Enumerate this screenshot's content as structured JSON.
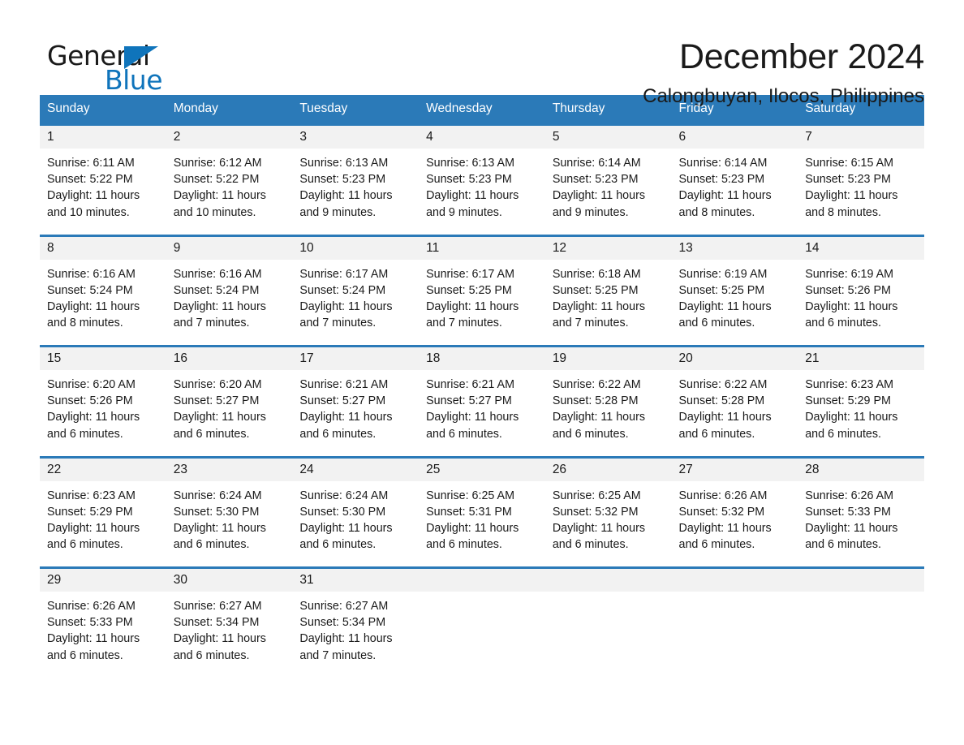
{
  "brand": {
    "name_part1": "General",
    "name_part2": "Blue",
    "triangle_color": "#0f74bb",
    "blue_color": "#0f74bb"
  },
  "header": {
    "month_title": "December 2024",
    "location": "Calongbuyan, Ilocos, Philippines"
  },
  "theme": {
    "header_bg": "#2b7ab8",
    "header_text": "#ffffff",
    "daynum_bg": "#f2f2f2",
    "row_border": "#2b7ab8",
    "page_bg": "#ffffff"
  },
  "weekdays": [
    "Sunday",
    "Monday",
    "Tuesday",
    "Wednesday",
    "Thursday",
    "Friday",
    "Saturday"
  ],
  "labels": {
    "sunrise_prefix": "Sunrise:",
    "sunset_prefix": "Sunset:",
    "daylight_prefix": "Daylight:"
  },
  "weeks": [
    [
      {
        "day": "1",
        "sunrise": "Sunrise: 6:11 AM",
        "sunset": "Sunset: 5:22 PM",
        "daylight_line1": "Daylight: 11 hours",
        "daylight_line2": "and 10 minutes."
      },
      {
        "day": "2",
        "sunrise": "Sunrise: 6:12 AM",
        "sunset": "Sunset: 5:22 PM",
        "daylight_line1": "Daylight: 11 hours",
        "daylight_line2": "and 10 minutes."
      },
      {
        "day": "3",
        "sunrise": "Sunrise: 6:13 AM",
        "sunset": "Sunset: 5:23 PM",
        "daylight_line1": "Daylight: 11 hours",
        "daylight_line2": "and 9 minutes."
      },
      {
        "day": "4",
        "sunrise": "Sunrise: 6:13 AM",
        "sunset": "Sunset: 5:23 PM",
        "daylight_line1": "Daylight: 11 hours",
        "daylight_line2": "and 9 minutes."
      },
      {
        "day": "5",
        "sunrise": "Sunrise: 6:14 AM",
        "sunset": "Sunset: 5:23 PM",
        "daylight_line1": "Daylight: 11 hours",
        "daylight_line2": "and 9 minutes."
      },
      {
        "day": "6",
        "sunrise": "Sunrise: 6:14 AM",
        "sunset": "Sunset: 5:23 PM",
        "daylight_line1": "Daylight: 11 hours",
        "daylight_line2": "and 8 minutes."
      },
      {
        "day": "7",
        "sunrise": "Sunrise: 6:15 AM",
        "sunset": "Sunset: 5:23 PM",
        "daylight_line1": "Daylight: 11 hours",
        "daylight_line2": "and 8 minutes."
      }
    ],
    [
      {
        "day": "8",
        "sunrise": "Sunrise: 6:16 AM",
        "sunset": "Sunset: 5:24 PM",
        "daylight_line1": "Daylight: 11 hours",
        "daylight_line2": "and 8 minutes."
      },
      {
        "day": "9",
        "sunrise": "Sunrise: 6:16 AM",
        "sunset": "Sunset: 5:24 PM",
        "daylight_line1": "Daylight: 11 hours",
        "daylight_line2": "and 7 minutes."
      },
      {
        "day": "10",
        "sunrise": "Sunrise: 6:17 AM",
        "sunset": "Sunset: 5:24 PM",
        "daylight_line1": "Daylight: 11 hours",
        "daylight_line2": "and 7 minutes."
      },
      {
        "day": "11",
        "sunrise": "Sunrise: 6:17 AM",
        "sunset": "Sunset: 5:25 PM",
        "daylight_line1": "Daylight: 11 hours",
        "daylight_line2": "and 7 minutes."
      },
      {
        "day": "12",
        "sunrise": "Sunrise: 6:18 AM",
        "sunset": "Sunset: 5:25 PM",
        "daylight_line1": "Daylight: 11 hours",
        "daylight_line2": "and 7 minutes."
      },
      {
        "day": "13",
        "sunrise": "Sunrise: 6:19 AM",
        "sunset": "Sunset: 5:25 PM",
        "daylight_line1": "Daylight: 11 hours",
        "daylight_line2": "and 6 minutes."
      },
      {
        "day": "14",
        "sunrise": "Sunrise: 6:19 AM",
        "sunset": "Sunset: 5:26 PM",
        "daylight_line1": "Daylight: 11 hours",
        "daylight_line2": "and 6 minutes."
      }
    ],
    [
      {
        "day": "15",
        "sunrise": "Sunrise: 6:20 AM",
        "sunset": "Sunset: 5:26 PM",
        "daylight_line1": "Daylight: 11 hours",
        "daylight_line2": "and 6 minutes."
      },
      {
        "day": "16",
        "sunrise": "Sunrise: 6:20 AM",
        "sunset": "Sunset: 5:27 PM",
        "daylight_line1": "Daylight: 11 hours",
        "daylight_line2": "and 6 minutes."
      },
      {
        "day": "17",
        "sunrise": "Sunrise: 6:21 AM",
        "sunset": "Sunset: 5:27 PM",
        "daylight_line1": "Daylight: 11 hours",
        "daylight_line2": "and 6 minutes."
      },
      {
        "day": "18",
        "sunrise": "Sunrise: 6:21 AM",
        "sunset": "Sunset: 5:27 PM",
        "daylight_line1": "Daylight: 11 hours",
        "daylight_line2": "and 6 minutes."
      },
      {
        "day": "19",
        "sunrise": "Sunrise: 6:22 AM",
        "sunset": "Sunset: 5:28 PM",
        "daylight_line1": "Daylight: 11 hours",
        "daylight_line2": "and 6 minutes."
      },
      {
        "day": "20",
        "sunrise": "Sunrise: 6:22 AM",
        "sunset": "Sunset: 5:28 PM",
        "daylight_line1": "Daylight: 11 hours",
        "daylight_line2": "and 6 minutes."
      },
      {
        "day": "21",
        "sunrise": "Sunrise: 6:23 AM",
        "sunset": "Sunset: 5:29 PM",
        "daylight_line1": "Daylight: 11 hours",
        "daylight_line2": "and 6 minutes."
      }
    ],
    [
      {
        "day": "22",
        "sunrise": "Sunrise: 6:23 AM",
        "sunset": "Sunset: 5:29 PM",
        "daylight_line1": "Daylight: 11 hours",
        "daylight_line2": "and 6 minutes."
      },
      {
        "day": "23",
        "sunrise": "Sunrise: 6:24 AM",
        "sunset": "Sunset: 5:30 PM",
        "daylight_line1": "Daylight: 11 hours",
        "daylight_line2": "and 6 minutes."
      },
      {
        "day": "24",
        "sunrise": "Sunrise: 6:24 AM",
        "sunset": "Sunset: 5:30 PM",
        "daylight_line1": "Daylight: 11 hours",
        "daylight_line2": "and 6 minutes."
      },
      {
        "day": "25",
        "sunrise": "Sunrise: 6:25 AM",
        "sunset": "Sunset: 5:31 PM",
        "daylight_line1": "Daylight: 11 hours",
        "daylight_line2": "and 6 minutes."
      },
      {
        "day": "26",
        "sunrise": "Sunrise: 6:25 AM",
        "sunset": "Sunset: 5:32 PM",
        "daylight_line1": "Daylight: 11 hours",
        "daylight_line2": "and 6 minutes."
      },
      {
        "day": "27",
        "sunrise": "Sunrise: 6:26 AM",
        "sunset": "Sunset: 5:32 PM",
        "daylight_line1": "Daylight: 11 hours",
        "daylight_line2": "and 6 minutes."
      },
      {
        "day": "28",
        "sunrise": "Sunrise: 6:26 AM",
        "sunset": "Sunset: 5:33 PM",
        "daylight_line1": "Daylight: 11 hours",
        "daylight_line2": "and 6 minutes."
      }
    ],
    [
      {
        "day": "29",
        "sunrise": "Sunrise: 6:26 AM",
        "sunset": "Sunset: 5:33 PM",
        "daylight_line1": "Daylight: 11 hours",
        "daylight_line2": "and 6 minutes."
      },
      {
        "day": "30",
        "sunrise": "Sunrise: 6:27 AM",
        "sunset": "Sunset: 5:34 PM",
        "daylight_line1": "Daylight: 11 hours",
        "daylight_line2": "and 6 minutes."
      },
      {
        "day": "31",
        "sunrise": "Sunrise: 6:27 AM",
        "sunset": "Sunset: 5:34 PM",
        "daylight_line1": "Daylight: 11 hours",
        "daylight_line2": "and 7 minutes."
      },
      {
        "day": "",
        "sunrise": "",
        "sunset": "",
        "daylight_line1": "",
        "daylight_line2": "",
        "empty": true
      },
      {
        "day": "",
        "sunrise": "",
        "sunset": "",
        "daylight_line1": "",
        "daylight_line2": "",
        "empty": true
      },
      {
        "day": "",
        "sunrise": "",
        "sunset": "",
        "daylight_line1": "",
        "daylight_line2": "",
        "empty": true
      },
      {
        "day": "",
        "sunrise": "",
        "sunset": "",
        "daylight_line1": "",
        "daylight_line2": "",
        "empty": true
      }
    ]
  ]
}
